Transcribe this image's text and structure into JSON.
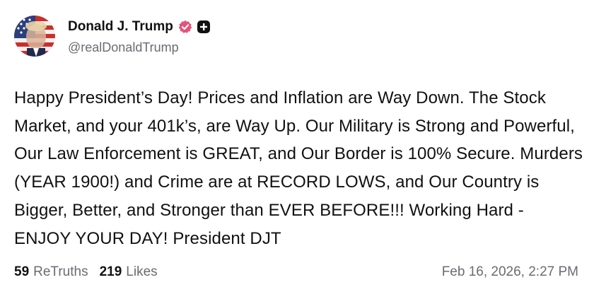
{
  "post": {
    "author": {
      "display_name": "Donald J. Trump",
      "handle": "@realDonaldTrump",
      "avatar_icon": "profile-photo-avatar",
      "verified_icon": "verified-badge-icon",
      "plus_icon": "plus-badge-icon"
    },
    "text": "Happy President’s Day! Prices and Inflation are Way Down. The Stock Market, and your 401k’s, are Way Up. Our Military is Strong and Powerful, Our Law Enforcement is GREAT, and Our Border is 100% Secure. Murders (YEAR 1900!) and Crime are at RECORD LOWS, and Our Country is Bigger, Better, and Stronger than EVER BEFORE!!! Working Hard - ENJOY YOUR DAY! President DJT",
    "stats": {
      "retruths_count": "59",
      "retruths_label": "ReTruths",
      "likes_count": "219",
      "likes_label": "Likes"
    },
    "timestamp": "Feb 16, 2026, 2:27 PM"
  },
  "colors": {
    "verified_badge": "#e5537a",
    "plus_badge": "#111111",
    "muted_text": "#6b6b72"
  }
}
